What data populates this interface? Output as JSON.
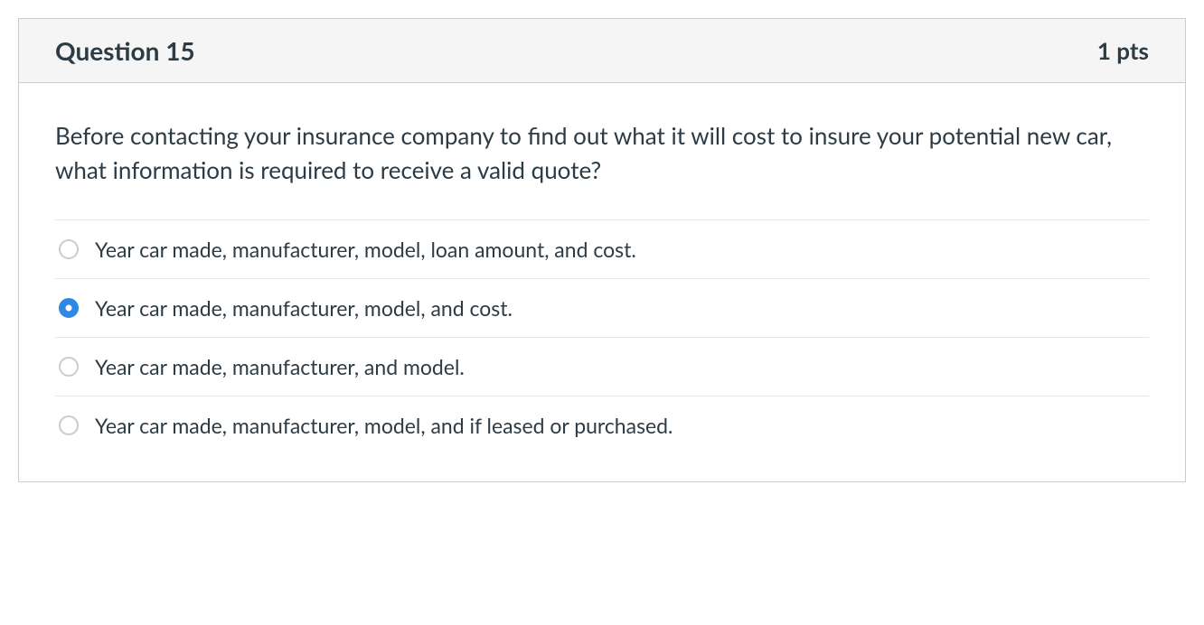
{
  "header": {
    "title": "Question 15",
    "points": "1 pts"
  },
  "prompt": "Before contacting your insurance company to find out what it will cost to insure your potential new car, what information is required to receive a valid quote?",
  "options": [
    {
      "label": "Year car made, manufacturer, model, loan amount, and cost.",
      "selected": false
    },
    {
      "label": "Year car made, manufacturer, model, and cost.",
      "selected": true
    },
    {
      "label": "Year car made, manufacturer, and model.",
      "selected": false
    },
    {
      "label": "Year car made, manufacturer, model, and if leased or purchased.",
      "selected": false
    }
  ]
}
